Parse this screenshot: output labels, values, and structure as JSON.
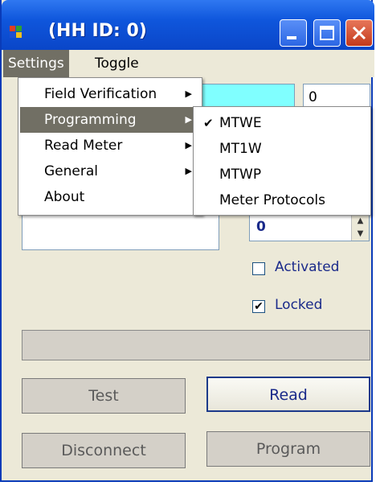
{
  "window": {
    "title": "(HH ID: 0)"
  },
  "menubar": {
    "settings_label": "Settings",
    "toggle_label": "Toggle"
  },
  "settings_menu": {
    "items": [
      {
        "label": "Field Verification",
        "submenu": true
      },
      {
        "label": "Programming",
        "submenu": true,
        "highlighted": true
      },
      {
        "label": "Read Meter",
        "submenu": true
      },
      {
        "label": "General",
        "submenu": true
      },
      {
        "label": "About",
        "submenu": false
      }
    ]
  },
  "programming_submenu": {
    "items": [
      {
        "label": "MTWE",
        "checked": true
      },
      {
        "label": "MT1W",
        "checked": false
      },
      {
        "label": "MTWP",
        "checked": false
      },
      {
        "label": "Meter Protocols",
        "checked": false
      }
    ]
  },
  "fields": {
    "top_right_value": "0",
    "spinner_value": "0"
  },
  "checkboxes": {
    "activated": {
      "label": "Activated",
      "checked": false
    },
    "locked": {
      "label": "Locked",
      "checked": true
    }
  },
  "buttons": {
    "test": "Test",
    "read": "Read",
    "disconnect": "Disconnect",
    "program": "Program"
  },
  "colors": {
    "highlight": "#716f64",
    "cyan_field": "#80ffff",
    "titlebar": "#0a46c8"
  }
}
